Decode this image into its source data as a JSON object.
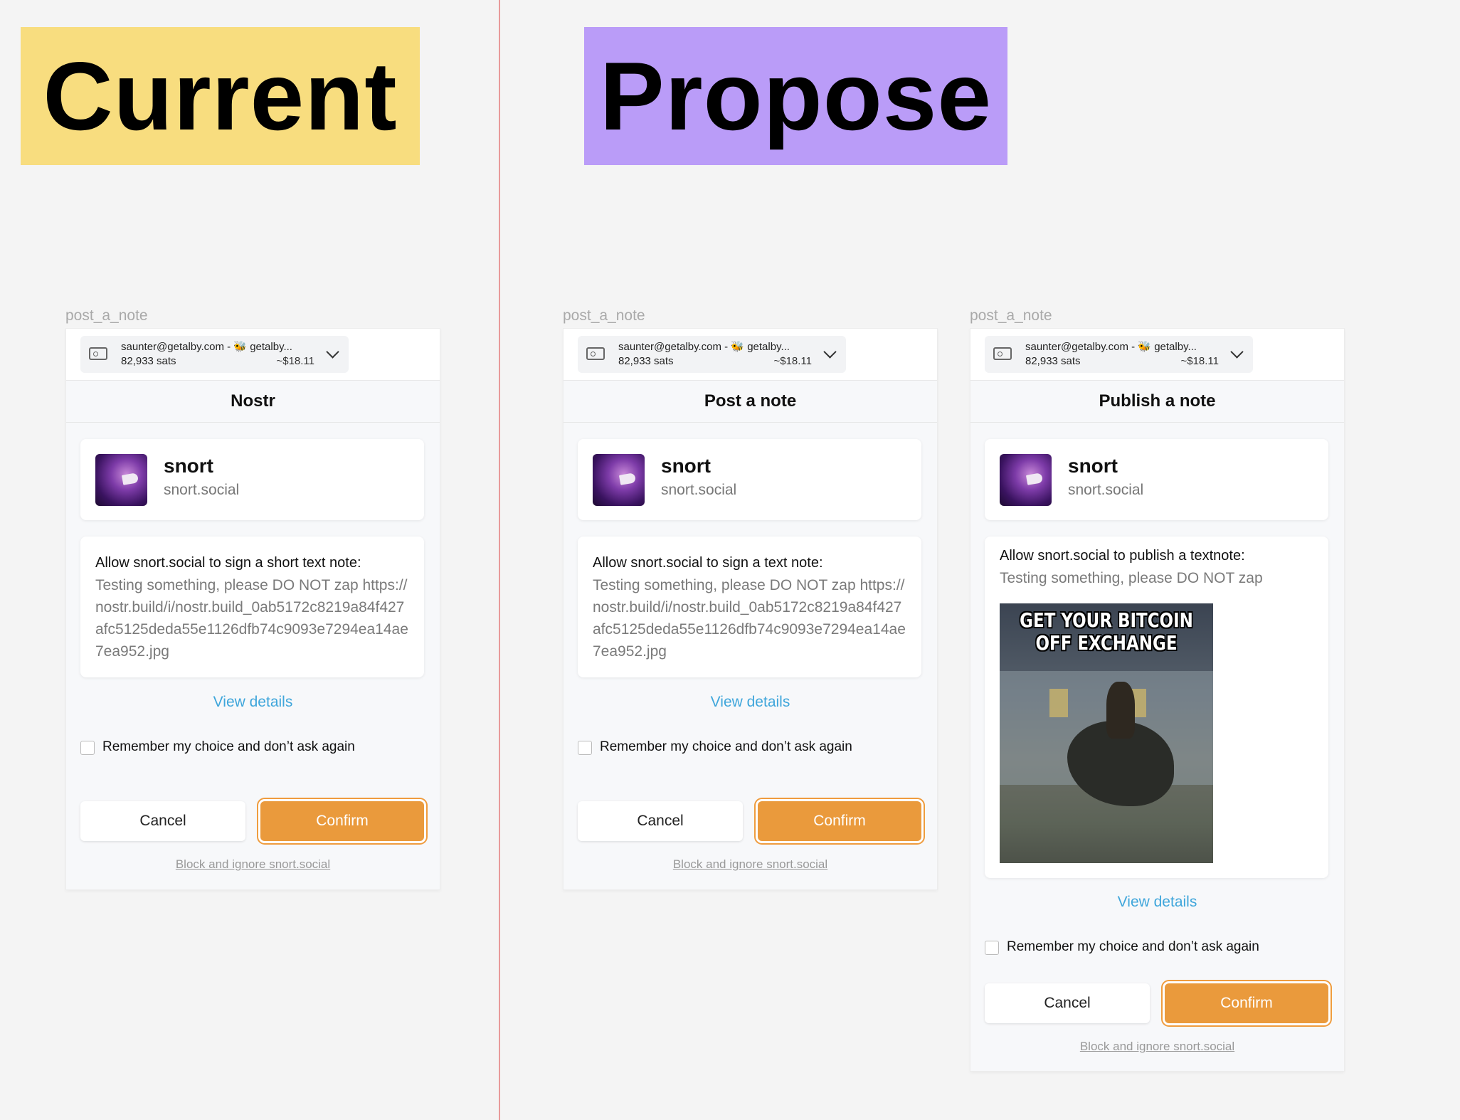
{
  "banners": {
    "current": "Current",
    "propose": "Propose"
  },
  "panels": [
    {
      "frame_label": "post_a_note",
      "account": {
        "email": "saunter@getalby.com - 🐝 getalby...",
        "balance": "82,933 sats",
        "fiat": "~$18.11"
      },
      "title": "Nostr",
      "site": {
        "name": "snort",
        "domain": "snort.social"
      },
      "message_heading": "Allow snort.social to sign a short text note:",
      "message_body": "Testing something, please DO NOT zap https://nostr.build/i/nostr.build_0ab5172c8219a84f427afc5125deda55e1126dfb74c9093e7294ea14ae7ea952.jpg",
      "view_details": "View details",
      "remember_label": "Remember my choice and don’t ask again",
      "cancel": "Cancel",
      "confirm": "Confirm",
      "block": "Block and ignore snort.social"
    },
    {
      "frame_label": "post_a_note",
      "account": {
        "email": "saunter@getalby.com - 🐝 getalby...",
        "balance": "82,933 sats",
        "fiat": "~$18.11"
      },
      "title": "Post a note",
      "site": {
        "name": "snort",
        "domain": "snort.social"
      },
      "message_heading": "Allow snort.social to sign a text note:",
      "message_body": "Testing something, please DO NOT zap https://nostr.build/i/nostr.build_0ab5172c8219a84f427afc5125deda55e1126dfb74c9093e7294ea14ae7ea952.jpg",
      "view_details": "View details",
      "remember_label": "Remember my choice and don’t ask again",
      "cancel": "Cancel",
      "confirm": "Confirm",
      "block": "Block and ignore snort.social"
    },
    {
      "frame_label": "post_a_note",
      "account": {
        "email": "saunter@getalby.com - 🐝 getalby...",
        "balance": "82,933 sats",
        "fiat": "~$18.11"
      },
      "title": "Publish a note",
      "site": {
        "name": "snort",
        "domain": "snort.social"
      },
      "message_heading": "Allow snort.social to publish a textnote:",
      "message_body": "Testing something, please DO NOT zap",
      "meme_text": "GET YOUR BITCOIN OFF EXCHANGE",
      "view_details": "View details",
      "remember_label": "Remember my choice and don’t ask again",
      "cancel": "Cancel",
      "confirm": "Confirm",
      "block": "Block and ignore snort.social"
    }
  ]
}
